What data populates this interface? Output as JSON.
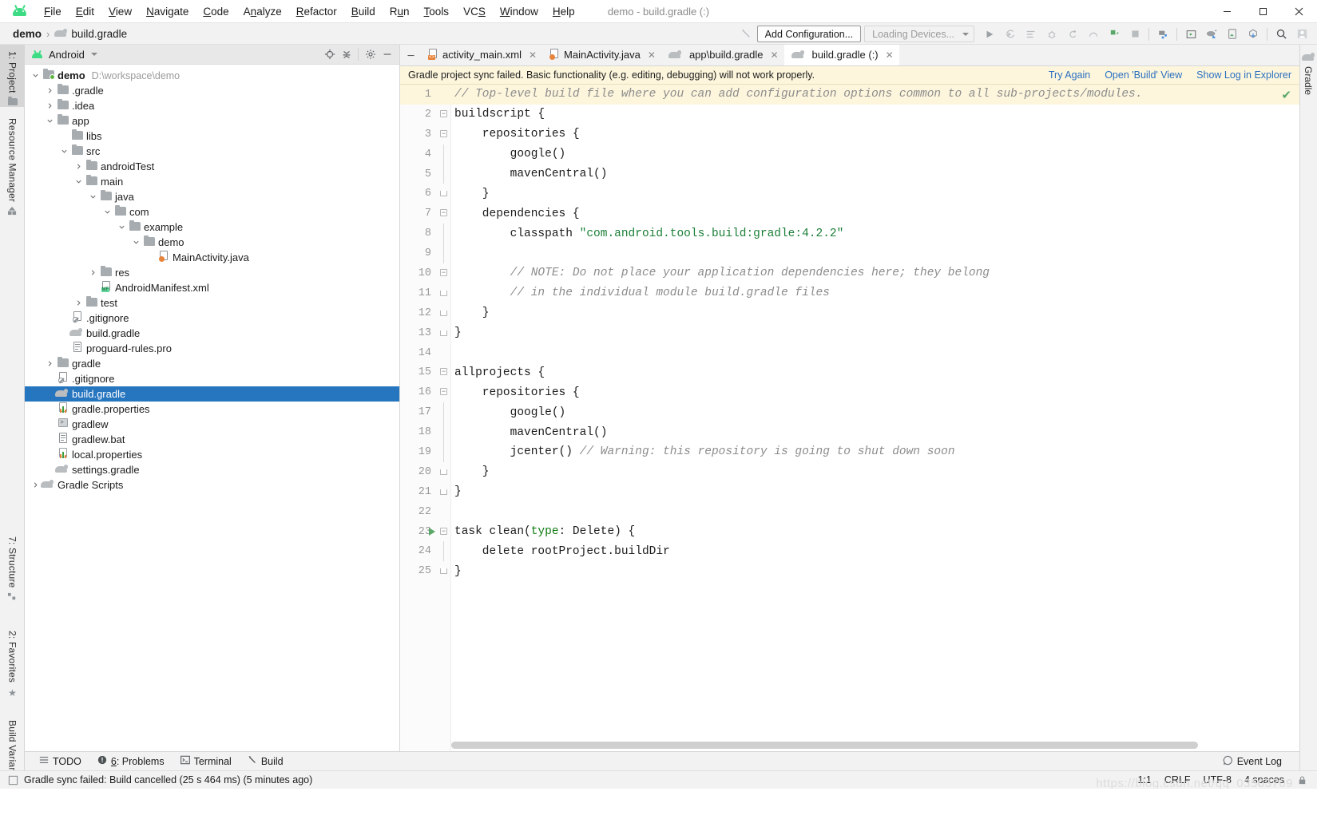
{
  "window": {
    "title": "demo - build.gradle (:)",
    "minimize": "—",
    "maximize": "☐",
    "close": "✕"
  },
  "menu": {
    "items": [
      "File",
      "Edit",
      "View",
      "Navigate",
      "Code",
      "Analyze",
      "Refactor",
      "Build",
      "Run",
      "Tools",
      "VCS",
      "Window",
      "Help"
    ]
  },
  "breadcrumb": {
    "project": "demo",
    "separator": "›",
    "file": "build.gradle"
  },
  "toolbar": {
    "add_configuration": "Add Configuration...",
    "devices": "Loading Devices...",
    "icons": [
      "build-hammer-icon",
      "run-icon",
      "run-coverage-icon",
      "run-profiler-icon",
      "debug-icon",
      "attach-debugger-icon",
      "profile-icon",
      "sync-gradle-icon",
      "stop-icon",
      "avd-manager-icon",
      "sdk-manager-icon",
      "device-file-explorer-icon",
      "layout-inspector-icon",
      "apk-analyzer-icon",
      "search-everywhere-icon",
      "account-icon"
    ]
  },
  "left_tool_strip": {
    "tabs": [
      {
        "label": "1: Project",
        "mnemonic": "1",
        "active": true,
        "icon": "folder-icon"
      },
      {
        "label": "Resource Manager",
        "mnemonic": "",
        "active": false,
        "icon": "resource-icon"
      }
    ],
    "bottom_tabs": [
      {
        "label": "7: Structure",
        "mnemonic": "7",
        "icon": "structure-icon"
      },
      {
        "label": "2: Favorites",
        "mnemonic": "2",
        "icon": "star-icon"
      },
      {
        "label": "Build Variants",
        "mnemonic": "",
        "icon": "android-icon"
      }
    ]
  },
  "right_tool_strip": {
    "tabs": [
      {
        "label": "Gradle",
        "icon": "gradle-elephant-icon"
      }
    ]
  },
  "project_panel": {
    "view_name": "Android",
    "header_icons": [
      "locate-icon",
      "collapse-all-icon",
      "settings-gear-icon",
      "hide-icon"
    ],
    "tree": [
      {
        "depth": 0,
        "arrow": "down",
        "icon": "module-folder-icon",
        "label": "demo",
        "bold": true,
        "path": "D:\\workspace\\demo",
        "selected": false
      },
      {
        "depth": 1,
        "arrow": "right",
        "icon": "folder-icon",
        "label": ".gradle",
        "bold": false,
        "path": "",
        "selected": false
      },
      {
        "depth": 1,
        "arrow": "right",
        "icon": "folder-icon",
        "label": ".idea",
        "bold": false,
        "path": "",
        "selected": false
      },
      {
        "depth": 1,
        "arrow": "down",
        "icon": "folder-icon",
        "label": "app",
        "bold": false,
        "path": "",
        "selected": false
      },
      {
        "depth": 2,
        "arrow": "none",
        "icon": "folder-icon",
        "label": "libs",
        "bold": false,
        "path": "",
        "selected": false
      },
      {
        "depth": 2,
        "arrow": "down",
        "icon": "folder-icon",
        "label": "src",
        "bold": false,
        "path": "",
        "selected": false
      },
      {
        "depth": 3,
        "arrow": "right",
        "icon": "folder-icon",
        "label": "androidTest",
        "bold": false,
        "path": "",
        "selected": false
      },
      {
        "depth": 3,
        "arrow": "down",
        "icon": "folder-icon",
        "label": "main",
        "bold": false,
        "path": "",
        "selected": false
      },
      {
        "depth": 4,
        "arrow": "down",
        "icon": "folder-icon",
        "label": "java",
        "bold": false,
        "path": "",
        "selected": false
      },
      {
        "depth": 5,
        "arrow": "down",
        "icon": "folder-icon",
        "label": "com",
        "bold": false,
        "path": "",
        "selected": false
      },
      {
        "depth": 6,
        "arrow": "down",
        "icon": "folder-icon",
        "label": "example",
        "bold": false,
        "path": "",
        "selected": false
      },
      {
        "depth": 7,
        "arrow": "down",
        "icon": "folder-icon",
        "label": "demo",
        "bold": false,
        "path": "",
        "selected": false
      },
      {
        "depth": 8,
        "arrow": "none",
        "icon": "java-file-icon",
        "label": "MainActivity.java",
        "bold": false,
        "path": "",
        "selected": false
      },
      {
        "depth": 4,
        "arrow": "right",
        "icon": "folder-icon",
        "label": "res",
        "bold": false,
        "path": "",
        "selected": false
      },
      {
        "depth": 4,
        "arrow": "none",
        "icon": "manifest-file-icon",
        "label": "AndroidManifest.xml",
        "bold": false,
        "path": "",
        "selected": false
      },
      {
        "depth": 3,
        "arrow": "right",
        "icon": "folder-icon",
        "label": "test",
        "bold": false,
        "path": "",
        "selected": false
      },
      {
        "depth": 2,
        "arrow": "none",
        "icon": "gitignore-file-icon",
        "label": ".gitignore",
        "bold": false,
        "path": "",
        "selected": false
      },
      {
        "depth": 2,
        "arrow": "none",
        "icon": "gradle-file-icon",
        "label": "build.gradle",
        "bold": false,
        "path": "",
        "selected": false
      },
      {
        "depth": 2,
        "arrow": "none",
        "icon": "text-file-icon",
        "label": "proguard-rules.pro",
        "bold": false,
        "path": "",
        "selected": false
      },
      {
        "depth": 1,
        "arrow": "right",
        "icon": "folder-icon",
        "label": "gradle",
        "bold": false,
        "path": "",
        "selected": false
      },
      {
        "depth": 1,
        "arrow": "none",
        "icon": "gitignore-file-icon",
        "label": ".gitignore",
        "bold": false,
        "path": "",
        "selected": false
      },
      {
        "depth": 1,
        "arrow": "none",
        "icon": "gradle-file-icon",
        "label": "build.gradle",
        "bold": false,
        "path": "",
        "selected": true
      },
      {
        "depth": 1,
        "arrow": "none",
        "icon": "properties-file-icon",
        "label": "gradle.properties",
        "bold": false,
        "path": "",
        "selected": false
      },
      {
        "depth": 1,
        "arrow": "none",
        "icon": "shell-file-icon",
        "label": "gradlew",
        "bold": false,
        "path": "",
        "selected": false
      },
      {
        "depth": 1,
        "arrow": "none",
        "icon": "text-file-icon",
        "label": "gradlew.bat",
        "bold": false,
        "path": "",
        "selected": false
      },
      {
        "depth": 1,
        "arrow": "none",
        "icon": "properties-file-icon",
        "label": "local.properties",
        "bold": false,
        "path": "",
        "selected": false
      },
      {
        "depth": 1,
        "arrow": "none",
        "icon": "gradle-file-icon",
        "label": "settings.gradle",
        "bold": false,
        "path": "",
        "selected": false
      },
      {
        "depth": 0,
        "arrow": "right",
        "icon": "gradle-file-icon",
        "label": "Gradle Scripts",
        "bold": false,
        "path": "",
        "selected": false
      }
    ]
  },
  "editor": {
    "tabs": [
      {
        "label": "activity_main.xml",
        "icon": "xml-layout-file-icon",
        "active": false
      },
      {
        "label": "MainActivity.java",
        "icon": "java-file-icon",
        "active": false
      },
      {
        "label": "app\\build.gradle",
        "icon": "gradle-file-icon",
        "active": false
      },
      {
        "label": "build.gradle (:)",
        "icon": "gradle-file-icon",
        "active": true
      }
    ],
    "notification": {
      "message": "Gradle project sync failed. Basic functionality (e.g. editing, debugging) will not work properly.",
      "links": [
        "Try Again",
        "Open 'Build' View",
        "Show Log in Explorer"
      ]
    },
    "lines": [
      {
        "n": 1,
        "text": "// Top-level build file where you can add configuration options common to all sub-projects/modules.",
        "kind": "comment",
        "fold": "",
        "highlight": true,
        "run": false
      },
      {
        "n": 2,
        "text": "buildscript {",
        "kind": "code",
        "fold": "start",
        "highlight": false,
        "run": false
      },
      {
        "n": 3,
        "text": "    repositories {",
        "kind": "code",
        "fold": "start-inner",
        "highlight": false,
        "run": false
      },
      {
        "n": 4,
        "text": "        google()",
        "kind": "code",
        "fold": "bar",
        "highlight": false,
        "run": false
      },
      {
        "n": 5,
        "text": "        mavenCentral()",
        "kind": "code",
        "fold": "bar",
        "highlight": false,
        "run": false
      },
      {
        "n": 6,
        "text": "    }",
        "kind": "code",
        "fold": "end",
        "highlight": false,
        "run": false
      },
      {
        "n": 7,
        "text": "    dependencies {",
        "kind": "code",
        "fold": "start-inner",
        "highlight": false,
        "run": false
      },
      {
        "n": 8,
        "text": "        classpath \"com.android.tools.build:gradle:4.2.2\"",
        "kind": "classpath",
        "fold": "bar",
        "highlight": false,
        "run": false
      },
      {
        "n": 9,
        "text": "",
        "kind": "code",
        "fold": "bar",
        "highlight": false,
        "run": false
      },
      {
        "n": 10,
        "text": "        // NOTE: Do not place your application dependencies here; they belong",
        "kind": "comment",
        "fold": "start-inner",
        "highlight": false,
        "run": false
      },
      {
        "n": 11,
        "text": "        // in the individual module build.gradle files",
        "kind": "comment",
        "fold": "end",
        "highlight": false,
        "run": false
      },
      {
        "n": 12,
        "text": "    }",
        "kind": "code",
        "fold": "end",
        "highlight": false,
        "run": false
      },
      {
        "n": 13,
        "text": "}",
        "kind": "code",
        "fold": "end",
        "highlight": false,
        "run": false
      },
      {
        "n": 14,
        "text": "",
        "kind": "code",
        "fold": "",
        "highlight": false,
        "run": false
      },
      {
        "n": 15,
        "text": "allprojects {",
        "kind": "code",
        "fold": "start",
        "highlight": false,
        "run": false
      },
      {
        "n": 16,
        "text": "    repositories {",
        "kind": "code",
        "fold": "start-inner",
        "highlight": false,
        "run": false
      },
      {
        "n": 17,
        "text": "        google()",
        "kind": "code",
        "fold": "bar",
        "highlight": false,
        "run": false
      },
      {
        "n": 18,
        "text": "        mavenCentral()",
        "kind": "code",
        "fold": "bar",
        "highlight": false,
        "run": false
      },
      {
        "n": 19,
        "text": "        jcenter() // Warning: this repository is going to shut down soon",
        "kind": "jcenter",
        "fold": "bar",
        "highlight": false,
        "run": false
      },
      {
        "n": 20,
        "text": "    }",
        "kind": "code",
        "fold": "end",
        "highlight": false,
        "run": false
      },
      {
        "n": 21,
        "text": "}",
        "kind": "code",
        "fold": "end",
        "highlight": false,
        "run": false
      },
      {
        "n": 22,
        "text": "",
        "kind": "code",
        "fold": "",
        "highlight": false,
        "run": false
      },
      {
        "n": 23,
        "text": "task clean(type: Delete) {",
        "kind": "task",
        "fold": "start",
        "highlight": false,
        "run": true
      },
      {
        "n": 24,
        "text": "    delete rootProject.buildDir",
        "kind": "code",
        "fold": "bar",
        "highlight": false,
        "run": false
      },
      {
        "n": 25,
        "text": "}",
        "kind": "code",
        "fold": "end",
        "highlight": false,
        "run": false
      }
    ],
    "inspection_status": "ok-check-icon"
  },
  "bottom_tool_bar": {
    "buttons": [
      {
        "label": "TODO",
        "mnemonic": "",
        "icon": "todo-list-icon"
      },
      {
        "label": "6: Problems",
        "mnemonic": "6",
        "icon": "problems-icon"
      },
      {
        "label": "Terminal",
        "mnemonic": "",
        "icon": "terminal-icon"
      },
      {
        "label": "Build",
        "mnemonic": "",
        "icon": "build-hammer-icon"
      }
    ],
    "event_log": "Event Log"
  },
  "status_bar": {
    "message": "Gradle sync failed: Build cancelled (25 s 464 ms) (5 minutes ago)",
    "caret_position": "1:1",
    "line_separator": "CRLF",
    "encoding": "UTF-8",
    "indent": "4 spaces",
    "watermark": "https://blog.csdn.net/qq_03503709"
  }
}
